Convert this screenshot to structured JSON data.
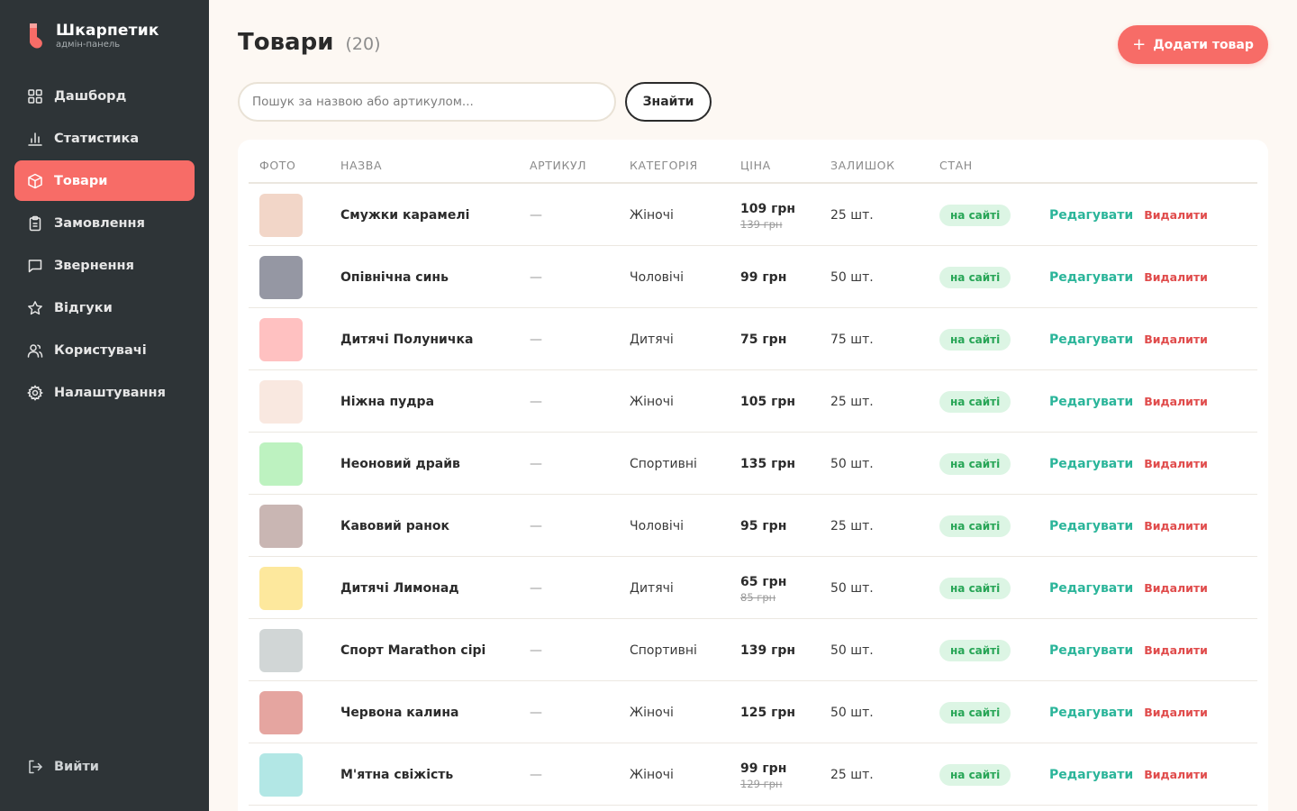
{
  "brand": {
    "name": "Шкарпетик",
    "subtitle": "адмін-панель",
    "logo_color": "#f76c67"
  },
  "sidebar": {
    "items": [
      {
        "label": "Дашборд",
        "icon": "grid-icon"
      },
      {
        "label": "Статистика",
        "icon": "bar-chart-icon"
      },
      {
        "label": "Товари",
        "icon": "box-icon",
        "active": true
      },
      {
        "label": "Замовлення",
        "icon": "clipboard-icon"
      },
      {
        "label": "Звернення",
        "icon": "message-icon"
      },
      {
        "label": "Відгуки",
        "icon": "star-icon"
      },
      {
        "label": "Користувачі",
        "icon": "users-icon"
      },
      {
        "label": "Налаштування",
        "icon": "gear-icon"
      }
    ],
    "logout_label": "Вийти"
  },
  "header": {
    "title": "Товари",
    "count": "(20)",
    "add_button": "Додати товар",
    "accent": "#f76c67"
  },
  "search": {
    "placeholder": "Пошук за назвою або артикулом...",
    "button": "Знайти"
  },
  "table": {
    "columns": [
      "ФОТО",
      "НАЗВА",
      "АРТИКУЛ",
      "КАТЕГОРІЯ",
      "ЦІНА",
      "ЗАЛИШОК",
      "СТАН"
    ],
    "edit_label": "Редагувати",
    "delete_label": "Видалити",
    "rows": [
      {
        "color": "#f2d6c8",
        "name": "Смужки карамелі",
        "sku": "—",
        "category": "Жіночі",
        "price": "109 грн",
        "old_price": "139 грн",
        "stock": "25 шт.",
        "status": "на сайті"
      },
      {
        "color": "#9597a3",
        "name": "Опівнічна синь",
        "sku": "—",
        "category": "Чоловічі",
        "price": "99 грн",
        "old_price": "",
        "stock": "50 шт.",
        "status": "на сайті"
      },
      {
        "color": "#ffc1c1",
        "name": "Дитячі Полуничка",
        "sku": "—",
        "category": "Дитячі",
        "price": "75 грн",
        "old_price": "",
        "stock": "75 шт.",
        "status": "на сайті"
      },
      {
        "color": "#f9e8e0",
        "name": "Ніжна пудра",
        "sku": "—",
        "category": "Жіночі",
        "price": "105 грн",
        "old_price": "",
        "stock": "25 шт.",
        "status": "на сайті"
      },
      {
        "color": "#bdf2c0",
        "name": "Неоновий драйв",
        "sku": "—",
        "category": "Спортивні",
        "price": "135 грн",
        "old_price": "",
        "stock": "50 шт.",
        "status": "на сайті"
      },
      {
        "color": "#c9b6b3",
        "name": "Кавовий ранок",
        "sku": "—",
        "category": "Чоловічі",
        "price": "95 грн",
        "old_price": "",
        "stock": "25 шт.",
        "status": "на сайті"
      },
      {
        "color": "#fde89d",
        "name": "Дитячі Лимонад",
        "sku": "—",
        "category": "Дитячі",
        "price": "65 грн",
        "old_price": "85 грн",
        "stock": "50 шт.",
        "status": "на сайті"
      },
      {
        "color": "#d1d6d6",
        "name": "Спорт Marathon сірі",
        "sku": "—",
        "category": "Спортивні",
        "price": "139 грн",
        "old_price": "",
        "stock": "50 шт.",
        "status": "на сайті"
      },
      {
        "color": "#e5a5a0",
        "name": "Червона калина",
        "sku": "—",
        "category": "Жіночі",
        "price": "125 грн",
        "old_price": "",
        "stock": "50 шт.",
        "status": "на сайті"
      },
      {
        "color": "#b2e7e5",
        "name": "М'ятна свіжість",
        "sku": "—",
        "category": "Жіночі",
        "price": "99 грн",
        "old_price": "129 грн",
        "stock": "25 шт.",
        "status": "на сайті"
      }
    ]
  }
}
